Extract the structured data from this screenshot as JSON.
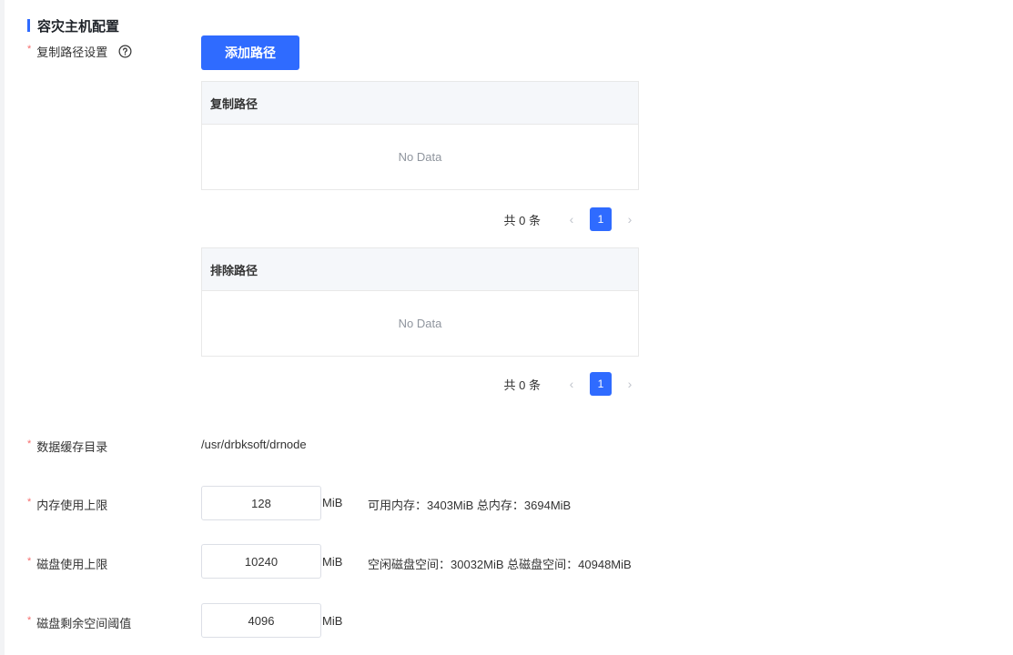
{
  "section": {
    "title": "容灾主机配置"
  },
  "replication": {
    "label": "复制路径设置",
    "add_button": "添加路径",
    "copy_table": {
      "header": "复制路径",
      "empty_text": "No Data"
    },
    "copy_pager": {
      "total": "共 0 条",
      "prev": "‹",
      "page": "1",
      "next": "›"
    },
    "exclude_table": {
      "header": "排除路径",
      "empty_text": "No Data"
    },
    "exclude_pager": {
      "total": "共 0 条",
      "prev": "‹",
      "page": "1",
      "next": "›"
    }
  },
  "cache_dir": {
    "label": "数据缓存目录",
    "value": "/usr/drbksoft/drnode"
  },
  "memory_limit": {
    "label": "内存使用上限",
    "value": "128",
    "unit": "MiB",
    "hint": "可用内存：3403MiB 总内存：3694MiB"
  },
  "disk_limit": {
    "label": "磁盘使用上限",
    "value": "10240",
    "unit": "MiB",
    "hint": "空闲磁盘空间：30032MiB 总磁盘空间：40948MiB"
  },
  "disk_threshold": {
    "label": "磁盘剩余空间阈值",
    "value": "4096",
    "unit": "MiB"
  },
  "required_mark": "*",
  "colors": {
    "primary": "#2f6bff",
    "required": "#f56c6c"
  }
}
